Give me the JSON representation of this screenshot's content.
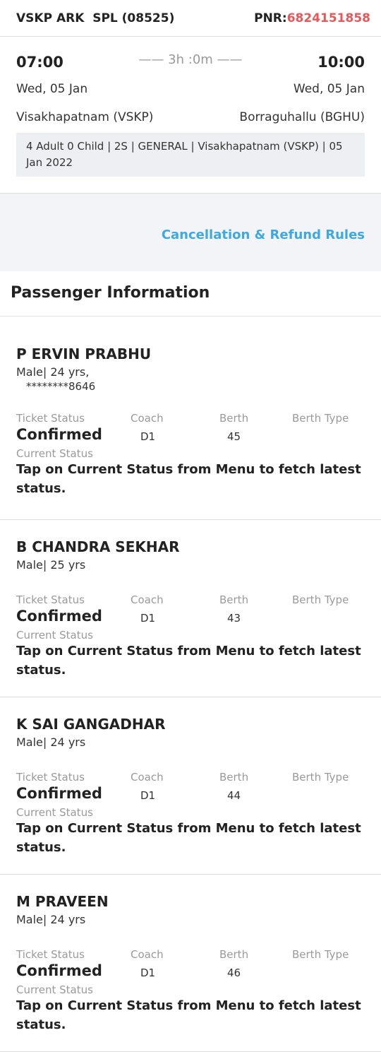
{
  "header": {
    "train": "VSKP ARK  SPL (08525)",
    "pnr_label": "PNR:",
    "pnr_value": "6824151858"
  },
  "journey": {
    "departure_time": "07:00",
    "arrival_time": "10:00",
    "duration": "—— 3h :0m ——",
    "departure_date": "Wed, 05 Jan",
    "arrival_date": "Wed, 05 Jan",
    "from_station": "Visakhapatnam (VSKP)",
    "to_station": "Borraguhallu (BGHU)",
    "summary": "4 Adult 0 Child | 2S | GENERAL | Visakhapatnam (VSKP) | 05 Jan 2022"
  },
  "rules_link": "Cancellation & Refund Rules",
  "section_title": "Passenger Information",
  "labels": {
    "ticket_status": "Ticket Status",
    "coach": "Coach",
    "berth": "Berth",
    "berth_type": "Berth Type",
    "current_status": "Current Status"
  },
  "passengers": [
    {
      "name": "P ERVIN PRABHU",
      "meta": "Male| 24 yrs,",
      "id": "********8646",
      "status": "Confirmed",
      "coach": "D1",
      "berth": "45",
      "current": "Tap on Current Status from Menu to fetch latest status."
    },
    {
      "name": "B CHANDRA SEKHAR",
      "meta": "Male| 25 yrs",
      "status": "Confirmed",
      "coach": "D1",
      "berth": "43",
      "current": "Tap on Current Status from Menu to fetch latest status."
    },
    {
      "name": "K SAI GANGADHAR",
      "meta": "Male| 24 yrs",
      "status": "Confirmed",
      "coach": "D1",
      "berth": "44",
      "current": "Tap on Current Status from Menu to fetch latest status."
    },
    {
      "name": "M PRAVEEN",
      "meta": "Male| 24 yrs",
      "status": "Confirmed",
      "coach": "D1",
      "berth": "46",
      "current": "Tap on Current Status from Menu to fetch latest status."
    }
  ],
  "colors": {
    "accent_link": "#3da9e0",
    "pnr": "#e8575a"
  }
}
